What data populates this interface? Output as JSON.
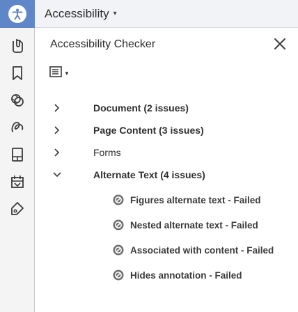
{
  "header": {
    "title": "Accessibility",
    "caret": "▾"
  },
  "panel": {
    "title": "Accessibility Checker",
    "close_icon": "close-icon",
    "options_icon": "options-menu-icon"
  },
  "rail": {
    "top_icon": "accessibility-icon",
    "icons": [
      "attach-icon",
      "bookmark-icon",
      "layers-icon",
      "signature-icon",
      "page-thumbnails-icon",
      "content-icon",
      "tag-icon"
    ],
    "accent_color": "#5f87c7"
  },
  "tree": {
    "items": [
      {
        "label": "Document (2 issues)",
        "expanded": false
      },
      {
        "label": "Page Content (3 issues)",
        "expanded": false
      },
      {
        "label": "Forms",
        "expanded": false
      },
      {
        "label": "Alternate Text (4 issues)",
        "expanded": true
      }
    ],
    "sub_items": [
      {
        "label": "Figures alternate text - Failed",
        "status": "failed"
      },
      {
        "label": "Nested alternate text - Failed",
        "status": "failed"
      },
      {
        "label": "Associated with content - Failed",
        "status": "failed"
      },
      {
        "label": "Hides annotation - Failed",
        "status": "failed"
      }
    ]
  }
}
